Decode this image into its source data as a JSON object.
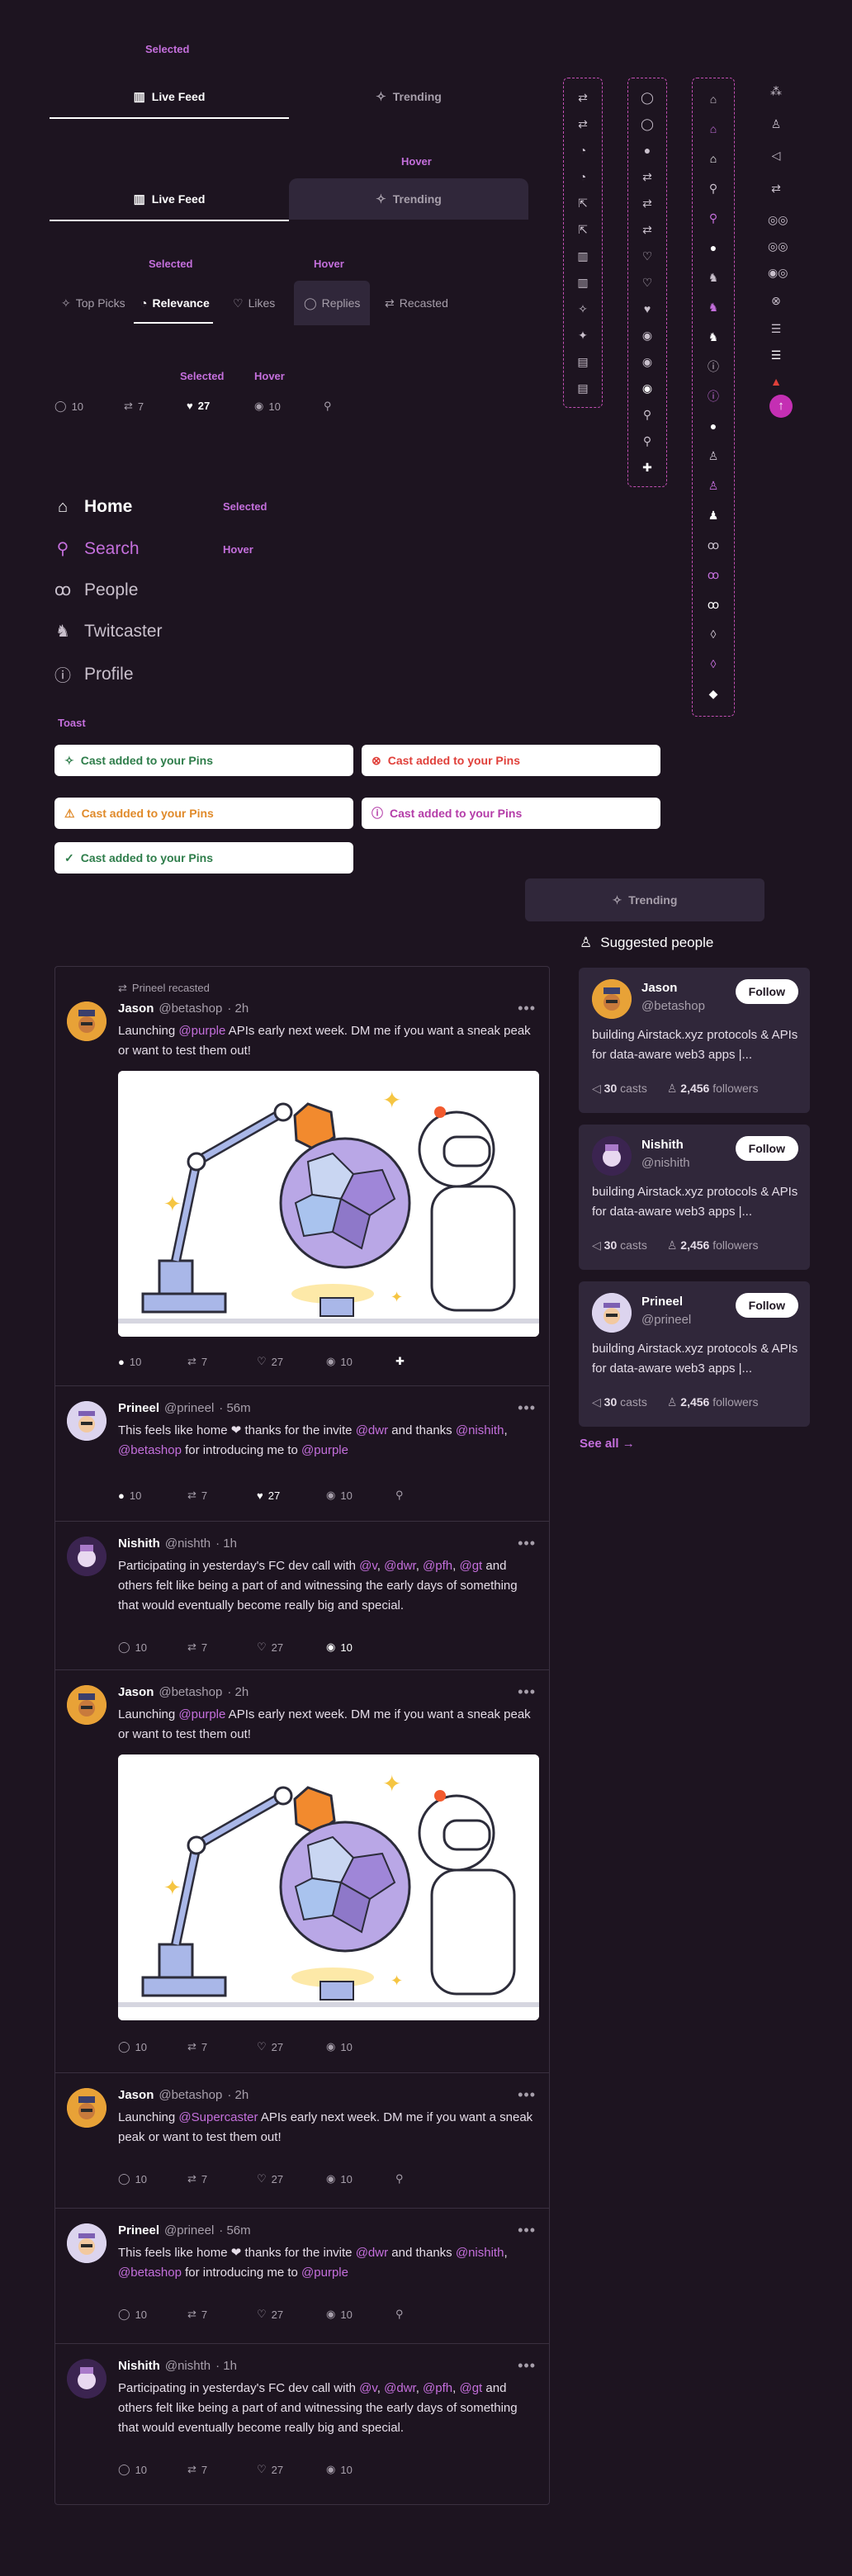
{
  "labels": {
    "selected": "Selected",
    "hover": "Hover",
    "toast": "Toast"
  },
  "tabs": {
    "live_feed": "Live Feed",
    "trending": "Trending"
  },
  "filters": [
    "Top Picks",
    "Relevance",
    "Likes",
    "Replies",
    "Recasted"
  ],
  "stats_row": {
    "replies": "10",
    "recasts": "7",
    "likes": "27",
    "views": "10"
  },
  "nav": [
    "Home",
    "Search",
    "People",
    "Twitcaster",
    "Profile"
  ],
  "toast_text": "Cast added to your Pins",
  "trending_button": "Trending",
  "suggested": {
    "title": "Suggested people",
    "follow": "Follow",
    "see_all": "See all →",
    "people": [
      {
        "name": "Jason",
        "handle": "@betashop",
        "bio": "building Airstack.xyz protocols & APIs for data-aware web3 apps |...",
        "casts": "30",
        "casts_label": "casts",
        "followers": "2,456",
        "followers_label": "followers"
      },
      {
        "name": "Nishith",
        "handle": "@nishith",
        "bio": "building Airstack.xyz protocols & APIs for data-aware web3 apps |...",
        "casts": "30",
        "casts_label": "casts",
        "followers": "2,456",
        "followers_label": "followers"
      },
      {
        "name": "Prineel",
        "handle": "@prineel",
        "bio": "building Airstack.xyz protocols & APIs for data-aware web3 apps |...",
        "casts": "30",
        "casts_label": "casts",
        "followers": "2,456",
        "followers_label": "followers"
      }
    ]
  },
  "feed": {
    "recast_label": "Prineel recasted",
    "posts": [
      {
        "name": "Jason",
        "handle": "@betashop",
        "time": "· 2h",
        "a": "Launching ",
        "m1": "@purple",
        "b": " APIs early next week. DM me if you want a sneak peak or want to test them out!"
      },
      {
        "name": "Prineel",
        "handle": "@prineel",
        "time": "· 56m",
        "a": "This feels like home ❤ thanks for the invite ",
        "m1": "@dwr",
        "b": " and thanks ",
        "m2": "@nishith",
        "c": ", ",
        "m3": "@betashop",
        "d": " for introducing me to ",
        "m4": "@purple"
      },
      {
        "name": "Nishith",
        "handle": "@nishth",
        "time": "· 1h",
        "a": "Participating in yesterday's FC dev call with ",
        "m1": "@v",
        "b": ", ",
        "m2": "@dwr",
        "c": ", ",
        "m3": "@pfh",
        "d": ", ",
        "m4": "@gt",
        "e": " and others felt like being a part of and witnessing the early days of something that would eventually become really big and special."
      },
      {
        "name": "Jason",
        "handle": "@betashop",
        "time": "· 2h",
        "a": "Launching ",
        "m1": "@purple",
        "b": " APIs early next week. DM me if you want a sneak peak or want to test them out!"
      },
      {
        "name": "Jason",
        "handle": "@betashop",
        "time": "· 2h",
        "a": "Launching ",
        "m1": "@Supercaster",
        "b": " APIs early next week. DM me if you want a sneak peak or want to test them out!"
      },
      {
        "name": "Prineel",
        "handle": "@prineel",
        "time": "· 56m",
        "a": "This feels like home ❤ thanks for the invite ",
        "m1": "@dwr",
        "b": " and thanks ",
        "m2": "@nishith",
        "c": ", ",
        "m3": "@betashop",
        "d": " for introducing me to ",
        "m4": "@purple"
      },
      {
        "name": "Nishith",
        "handle": "@nishth",
        "time": "· 1h",
        "a": "Participating in yesterday's FC dev call with ",
        "m1": "@v",
        "b": ", ",
        "m2": "@dwr",
        "c": ", ",
        "m3": "@pfh",
        "d": ", ",
        "m4": "@gt",
        "e": " and others felt like being a part of and witnessing the early days of something that would eventually become really big and special."
      }
    ]
  },
  "colors": {
    "background": "#1d1420",
    "accent": "#c46fdc",
    "card": "#30273a",
    "error": "#e0403a",
    "warning": "#e08a2a",
    "success": "#2e7d4a"
  }
}
